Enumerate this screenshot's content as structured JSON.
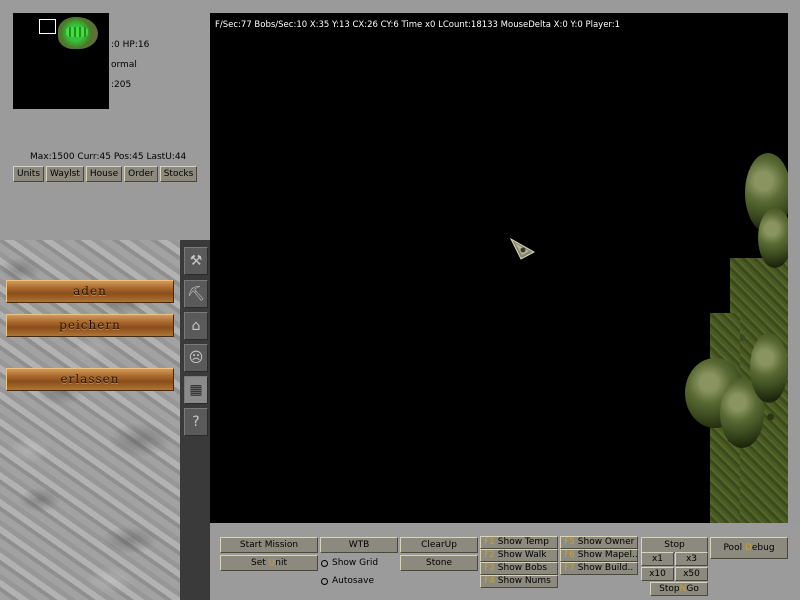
{
  "minimap": {
    "status_hp": ":0 HP:16",
    "status_mode": "ormal",
    "status_count": ":205"
  },
  "pool_info": "Max:1500 Curr:45 Pos:45 LastU:44",
  "tabs": [
    {
      "label": "Units"
    },
    {
      "label": "Waylst"
    },
    {
      "label": "House"
    },
    {
      "label": "Order"
    },
    {
      "label": "Stocks"
    }
  ],
  "side_icons": [
    {
      "name": "hammer-icon",
      "glyph": "⚒"
    },
    {
      "name": "pickaxe-icon",
      "glyph": "⛏"
    },
    {
      "name": "house-icon",
      "glyph": "⌂"
    },
    {
      "name": "face-icon",
      "glyph": "☹"
    },
    {
      "name": "map-icon",
      "glyph": "▦"
    },
    {
      "name": "question-icon",
      "glyph": "?"
    }
  ],
  "menu_buttons": {
    "load": "aden",
    "save": "peichern",
    "quit": "erlassen"
  },
  "hud": {
    "line": "F/Sec:77 Bobs/Sec:10 X:35 Y:13 CX:26 CY:6 Time x0 LCount:18133 MouseDelta X:0 Y:0 Player:1"
  },
  "debug": {
    "start_mission": "Start Mission",
    "set_unit_key": "U",
    "set_unit_pre": "Set ",
    "set_unit_post": "nit",
    "wtb": "WTB",
    "show_grid_pre": "Show G",
    "show_grid_key": "r",
    "show_grid_post": "id",
    "autosave_key": "A",
    "autosave_post": "utosave",
    "clearup": "ClearUp",
    "stone": "Stone",
    "f1": "F1",
    "show_temp": "Show Temp",
    "f2": "F2",
    "show_walk": "Show Walk",
    "f3": "F3",
    "show_bobs": "Show Bobs",
    "f4": "F4",
    "show_nums": "Show Nums",
    "f5": "F5",
    "show_owner": "Show Owner",
    "f6": "F6",
    "show_mapel": "Show Mapel..",
    "f7": "F7",
    "show_build": "Show Build..",
    "stop": "Stop",
    "x1": "x1",
    "x3": "x3",
    "x10": "x10",
    "x50": "x50",
    "stopngo_pre": "Stop",
    "stopngo_key": "N",
    "stopngo_post": "Go",
    "pool_pre": "Pool ",
    "pool_key": "D",
    "pool_post": "ebug"
  }
}
